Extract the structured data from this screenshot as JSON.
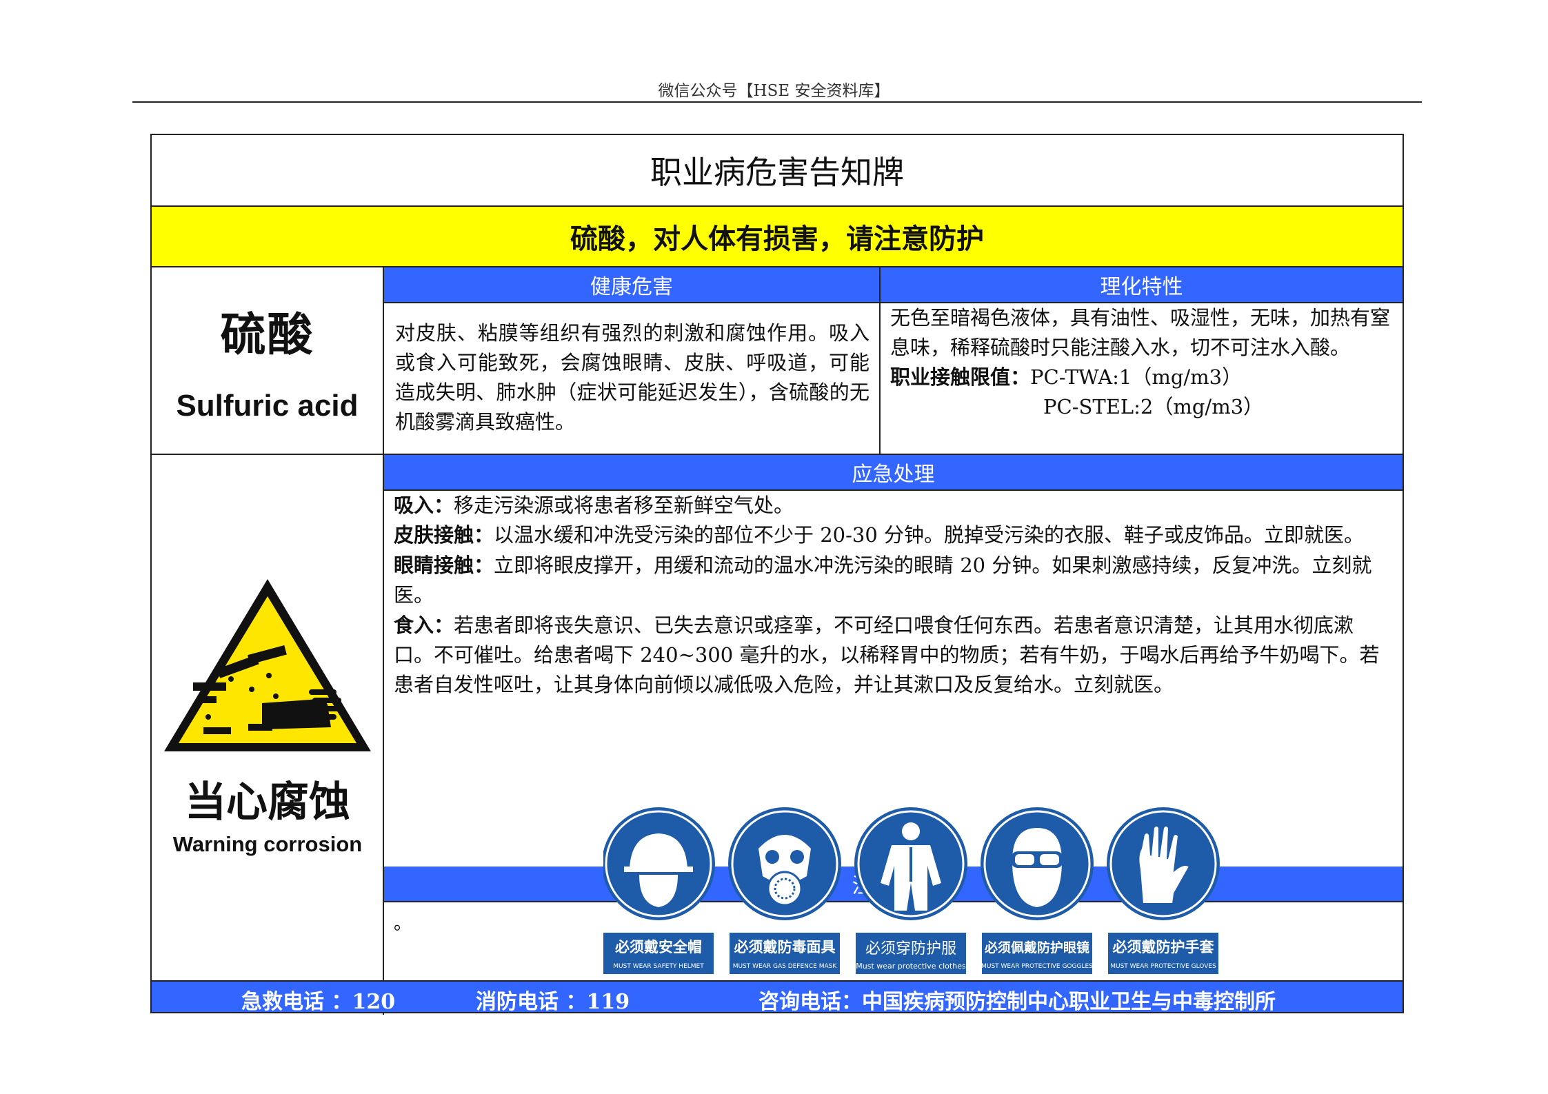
{
  "header": {
    "source": "微信公众号【HSE 安全资料库】"
  },
  "board": {
    "title": "职业病危害告知牌",
    "warning": "硫酸，对人体有损害，请注意防护",
    "chemical_cn": "硫酸",
    "chemical_en": "Sulfuric acid"
  },
  "health": {
    "heading": "健康危害",
    "text": "对皮肤、粘膜等组织有强烈的刺激和腐蚀作用。吸入或食入可能致死，会腐蚀眼睛、皮肤、呼吸道，可能造成失明、肺水肿（症状可能延迟发生），含硫酸的无机酸雾滴具致癌性。"
  },
  "properties": {
    "heading": "理化特性",
    "text": "无色至暗褐色液体，具有油性、吸湿性，无味，加热有窒息味，稀释硫酸时只能注酸入水，切不可注水入酸。",
    "limit_label": "职业接触限值：",
    "limit_twa": "PC-TWA:1（mg/m3）",
    "limit_stel": "PC-STEL:2（mg/m3）"
  },
  "sign": {
    "label_cn": "当心腐蚀",
    "label_en": "Warning corrosion",
    "icon": "corrosion-warning-icon"
  },
  "emergency": {
    "heading": "应急处理",
    "items": [
      {
        "label": "吸入：",
        "text": "移走污染源或将患者移至新鲜空气处。"
      },
      {
        "label": "皮肤接触：",
        "text": "以温水缓和冲洗受污染的部位不少于 20-30 分钟。脱掉受污染的衣服、鞋子或皮饰品。立即就医。"
      },
      {
        "label": "眼睛接触：",
        "text": "立即将眼皮撑开，用缓和流动的温水冲洗污染的眼睛 20 分钟。如果刺激感持续，反复冲洗。立刻就医。"
      },
      {
        "label": "食入：",
        "text": "若患者即将丧失意识、已失去意识或痉挛，不可经口喂食任何东西。若患者意识清楚，让其用水彻底漱口。不可催吐。给患者喝下 240~300 毫升的水，以稀释胃中的物质；若有牛奶，于喝水后再给予牛奶喝下。若患者自发性呕吐，让其身体向前倾以减低吸入危险，并让其漱口及反复给水。立刻就医。"
      }
    ]
  },
  "protection": {
    "heading": "注意防护",
    "note": "。",
    "signs": [
      {
        "cn": "必须戴安全帽",
        "en": "MUST WEAR SAFETY HELMET",
        "icon": "helmet-icon"
      },
      {
        "cn": "必须戴防毒面具",
        "en": "MUST WEAR GAS DEFENCE MASK",
        "icon": "gas-mask-icon"
      },
      {
        "cn": "必须穿防护服",
        "en": "Must wear protective clothes",
        "icon": "protective-suit-icon"
      },
      {
        "cn": "必须佩戴防护眼镜",
        "en": "MUST WEAR PROTECTIVE GOGGLES",
        "icon": "goggles-icon"
      },
      {
        "cn": "必须戴防护手套",
        "en": "MUST WEAR PROTECTIVE GLOVES",
        "icon": "gloves-icon"
      }
    ],
    "colors": {
      "blue": "#1e5ba8",
      "caption_bg": "#1e5ba8"
    }
  },
  "footer": {
    "first_aid": "急救电话 ：120",
    "fire": "消防电话 ：119",
    "consult": "咨询电话：中国疾病预防控制中心职业卫生与中毒控制所"
  },
  "colors": {
    "accent_blue": "#3366ff",
    "warning_yellow": "#ffff00"
  }
}
